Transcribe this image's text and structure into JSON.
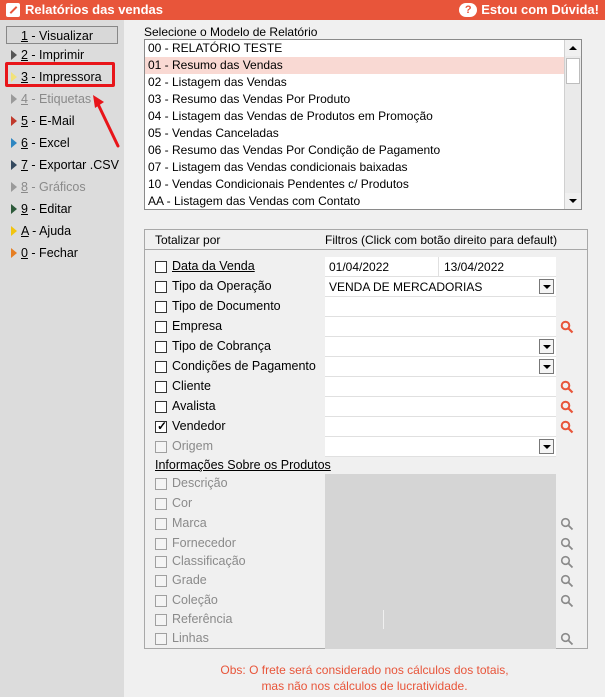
{
  "window": {
    "title": "Relatórios das vendas",
    "help_label": "Estou com Dúvida!"
  },
  "sidebar": {
    "items": [
      {
        "key": "1",
        "label": " - Visualizar",
        "enabled": true
      },
      {
        "key": "2",
        "label": " - Imprimir",
        "enabled": true
      },
      {
        "key": "3",
        "label": " - Impressora",
        "enabled": true
      },
      {
        "key": "4",
        "label": " - Etiquetas",
        "enabled": false
      },
      {
        "key": "5",
        "label": " - E-Mail",
        "enabled": true
      },
      {
        "key": "6",
        "label": " - Excel",
        "enabled": true
      },
      {
        "key": "7",
        "label": " - Exportar .CSV",
        "enabled": true
      },
      {
        "key": "8",
        "label": " - Gráficos",
        "enabled": false
      },
      {
        "key": "9",
        "label": " - Editar",
        "enabled": true
      },
      {
        "key": "A",
        "label": " - Ajuda",
        "enabled": true
      },
      {
        "key": "0",
        "label": " - Fechar",
        "enabled": true
      }
    ]
  },
  "report_model": {
    "label": "Selecione o Modelo de Relatório",
    "items": [
      "00 - RELATÓRIO TESTE",
      "01 - Resumo das Vendas",
      "02 - Listagem das Vendas",
      "03 - Resumo das Vendas Por Produto",
      "04 - Listagem das Vendas de Produtos em Promoção",
      "05 - Vendas Canceladas",
      "06 - Resumo das Vendas Por Condição de Pagamento",
      "07 - Listagem das Vendas condicionais baixadas",
      "10 - Vendas Condicionais Pendentes c/ Produtos",
      "AA - Listagem das Vendas com Contato"
    ],
    "selected_index": 1
  },
  "filters": {
    "header_totalizar": "Totalizar por",
    "header_filtros": "Filtros (Click com botão direito para default)",
    "rows": [
      {
        "label": "Data da Venda",
        "checked": false,
        "value": "01/04/2022",
        "value2": "13/04/2022"
      },
      {
        "label": "Tipo da Operação",
        "checked": false,
        "value": "VENDA DE MERCADORIAS"
      },
      {
        "label": "Tipo de Documento",
        "checked": false,
        "value": ""
      },
      {
        "label": "Empresa",
        "checked": false,
        "value": ""
      },
      {
        "label": "Tipo de Cobrança",
        "checked": false,
        "value": ""
      },
      {
        "label": "Condições de Pagamento",
        "checked": false,
        "value": ""
      },
      {
        "label": "Cliente",
        "checked": false,
        "value": ""
      },
      {
        "label": "Avalista",
        "checked": false,
        "value": ""
      },
      {
        "label": "Vendedor",
        "checked": true,
        "value": ""
      },
      {
        "label": "Origem",
        "checked": false,
        "value": ""
      }
    ],
    "products_heading": "Informações Sobre os Produtos",
    "product_rows": [
      {
        "label": "Descrição"
      },
      {
        "label": "Cor"
      },
      {
        "label": "Marca"
      },
      {
        "label": "Fornecedor"
      },
      {
        "label": "Classificação"
      },
      {
        "label": "Grade"
      },
      {
        "label": "Coleção"
      },
      {
        "label": "Referência"
      },
      {
        "label": "Linhas"
      }
    ]
  },
  "note": {
    "line1": "Obs: O frete será considerado nos cálculos dos totais,",
    "line2": "mas não nos cálculos de lucratividade."
  },
  "colors": {
    "accent": "#e8553a",
    "selected_row": "#f9d9d3",
    "highlight": "#e8151a"
  }
}
